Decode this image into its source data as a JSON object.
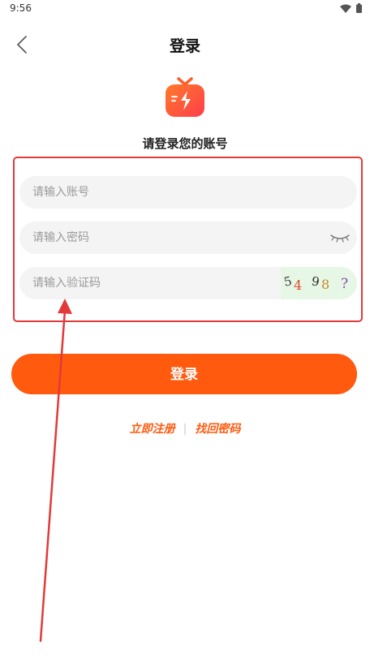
{
  "status_bar": {
    "time": "9:56"
  },
  "nav": {
    "title": "登录"
  },
  "subtitle": "请登录您的账号",
  "form": {
    "account_placeholder": "请输入账号",
    "password_placeholder": "请输入密码",
    "captcha_placeholder": "请输入验证码",
    "captcha_chars": [
      "5",
      "4",
      "9",
      "8",
      "?"
    ]
  },
  "login_button": "登录",
  "links": {
    "register": "立即注册",
    "separator": "|",
    "forgot_password": "找回密码"
  },
  "colors": {
    "accent": "#ff5a0e",
    "highlight_box": "#e23a3a",
    "field_bg": "#f4f4f4",
    "captcha_bg": "#e6f7e6"
  },
  "icons": {
    "back": "chevron-left-icon",
    "wifi": "wifi-icon",
    "battery": "battery-icon",
    "logo": "tv-lightning-logo",
    "eye": "eye-closed-icon"
  }
}
